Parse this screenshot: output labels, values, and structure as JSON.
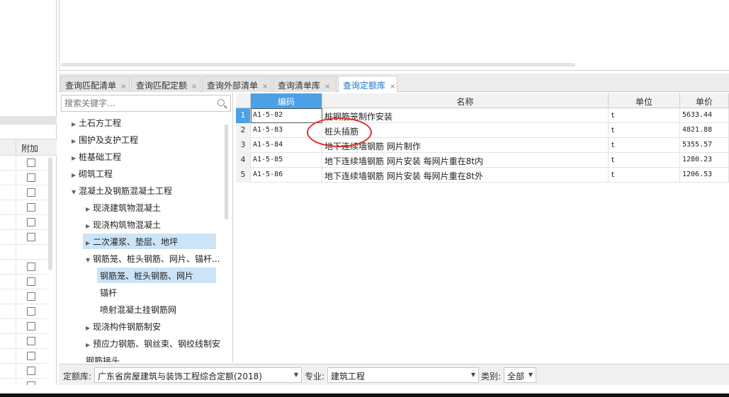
{
  "left_panel": {
    "header_label": "附加",
    "checkbox_rows": [
      true,
      true,
      true,
      true,
      true,
      true,
      false,
      true,
      true,
      true,
      true,
      true,
      true,
      true,
      true,
      true
    ]
  },
  "tabs": [
    {
      "label": "查询匹配清单",
      "active": false
    },
    {
      "label": "查询匹配定额",
      "active": false
    },
    {
      "label": "查询外部清单",
      "active": false
    },
    {
      "label": "查询清单库",
      "active": false
    },
    {
      "label": "查询定额库",
      "active": true
    }
  ],
  "tab_close_glyph": "×",
  "search": {
    "placeholder": "搜索关键字..."
  },
  "tree": [
    {
      "label": "土石方工程",
      "arrow": "right",
      "selected": false
    },
    {
      "label": "围护及支护工程",
      "arrow": "right",
      "selected": false
    },
    {
      "label": "桩基础工程",
      "arrow": "right",
      "selected": false
    },
    {
      "label": "砌筑工程",
      "arrow": "right",
      "selected": false
    },
    {
      "label": "混凝土及钢筋混凝土工程",
      "arrow": "down",
      "selected": false
    },
    {
      "label": "现浇建筑物混凝土",
      "arrow": "right",
      "selected": false
    },
    {
      "label": "现浇构筑物混凝土",
      "arrow": "right",
      "selected": false
    },
    {
      "label": "二次灌浆、垫层、地坪",
      "arrow": "right",
      "selected": true
    },
    {
      "label": "钢筋笼、桩头钢筋、网片、锚杆...",
      "arrow": "down",
      "selected": false
    },
    {
      "label": "钢筋笼、桩头钢筋、网片",
      "arrow": "none",
      "selected": true
    },
    {
      "label": "锚杆",
      "arrow": "none",
      "selected": false
    },
    {
      "label": "喷射混凝土挂钢筋网",
      "arrow": "none",
      "selected": false
    },
    {
      "label": "现浇构件钢筋制安",
      "arrow": "right",
      "selected": false
    },
    {
      "label": "预应力钢筋、钢丝束、钢绞线制安",
      "arrow": "right",
      "selected": false
    },
    {
      "label": "钢筋接头",
      "arrow": "none",
      "selected": false
    }
  ],
  "grid": {
    "columns": {
      "code": "编码",
      "name": "名称",
      "unit": "单位",
      "price": "单价"
    },
    "rows": [
      {
        "n": "1",
        "code": "A1-5-82",
        "name": "桩钢筋笼制作安装",
        "unit": "t",
        "price": "5633.44"
      },
      {
        "n": "2",
        "code": "A1-5-83",
        "name": "桩头插筋",
        "unit": "t",
        "price": "4821.88"
      },
      {
        "n": "3",
        "code": "A1-5-84",
        "name": "地下连续墙钢筋 网片制作",
        "unit": "t",
        "price": "5355.57"
      },
      {
        "n": "4",
        "code": "A1-5-85",
        "name": "地下连续墙钢筋 网片安装 每网片重在8t内",
        "unit": "t",
        "price": "1280.23"
      },
      {
        "n": "5",
        "code": "A1-5-86",
        "name": "地下连续墙钢筋 网片安装 每网片重在8t外",
        "unit": "t",
        "price": "1206.53"
      }
    ]
  },
  "bottom": {
    "quota_label": "定额库:",
    "quota_value": "广东省房屋建筑与装饰工程综合定额(2018)",
    "major_label": "专业:",
    "major_value": "建筑工程",
    "category_label": "类别:",
    "category_value": "全部"
  },
  "colors": {
    "accent": "#4ba0e6",
    "selection": "#cce4f7",
    "annotation": "#e0302a",
    "active_tab_text": "#1e74c8"
  }
}
